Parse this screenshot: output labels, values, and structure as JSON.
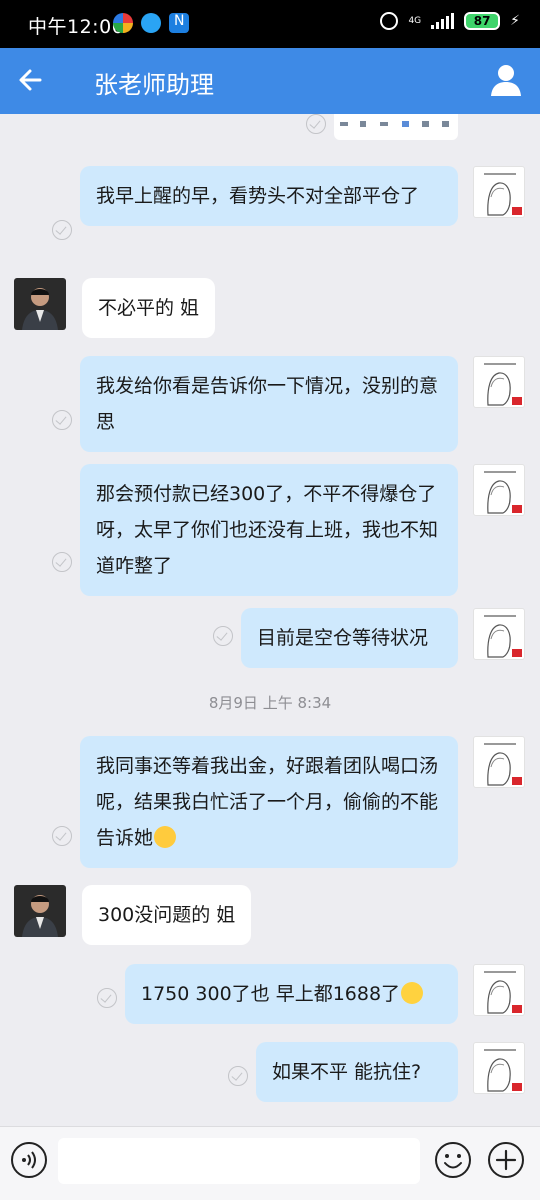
{
  "status_bar": {
    "time": "中午12:06",
    "network": "4G",
    "battery": "87"
  },
  "header": {
    "title": "张老师助理"
  },
  "messages": [
    {
      "text": "我早上醒的早，看势头不对全部平仓了"
    },
    {
      "text": "不必平的 姐"
    },
    {
      "text": "我发给你看是告诉你一下情况，没别的意思"
    },
    {
      "text": "那会预付款已经300了，不平不得爆仓了呀，太早了你们也还没有上班，我也不知道咋整了"
    },
    {
      "text": "目前是空仓等待状况"
    },
    {
      "timestamp": "8月9日  上午 8:34"
    },
    {
      "text": "我同事还等着我出金，好跟着团队喝口汤呢，结果我白忙活了一个月，偷偷的不能告诉她"
    },
    {
      "text": "300没问题的 姐"
    },
    {
      "text": "1750  300了也   早上都1688了"
    },
    {
      "text": "如果不平 能抗住?"
    }
  ],
  "input": {
    "value": ""
  },
  "colors": {
    "header_bg": "#3e8ae6",
    "outgoing_bubble": "#cfe9fd",
    "incoming_bubble": "#ffffff",
    "chat_bg": "#ededf1"
  }
}
